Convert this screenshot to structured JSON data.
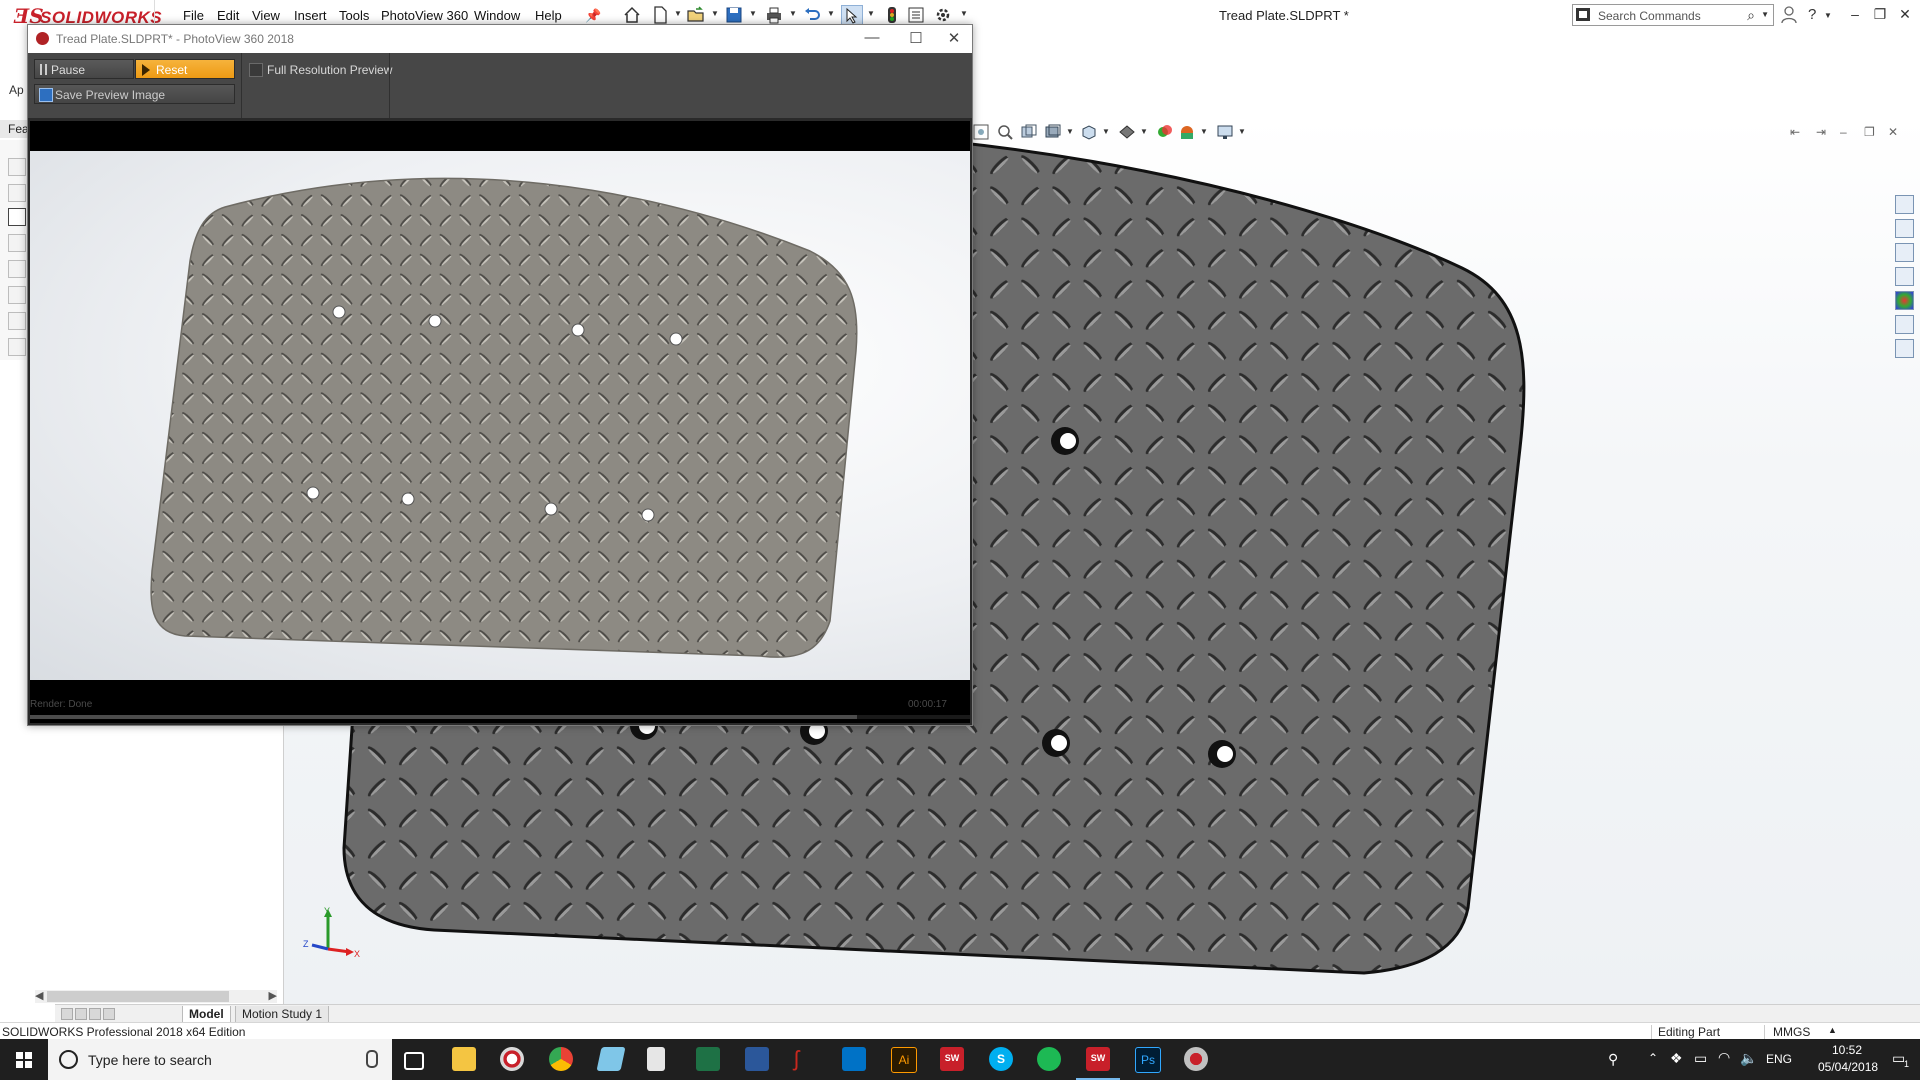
{
  "app": {
    "brand_prefix": "3DS",
    "brand": "SOLIDWORKS",
    "doc_title": "Tread Plate.SLDPRT *",
    "menus": [
      "File",
      "Edit",
      "View",
      "Insert",
      "Tools",
      "PhotoView 360",
      "Window",
      "Help"
    ],
    "search_placeholder": "Search Commands",
    "window_controls": {
      "minimize": "–",
      "restore": "❐",
      "close": "✕"
    }
  },
  "command_manager": {
    "tab_partial": "Ap"
  },
  "feature_panel": {
    "tab_partial": "Fea"
  },
  "bottom_tabs": {
    "model": "Model",
    "motion": "Motion Study 1"
  },
  "statusbar": {
    "edition": "SOLIDWORKS Professional 2018 x64 Edition",
    "mode": "Editing Part",
    "units": "MMGS",
    "units_arrow": "▲"
  },
  "triad": {
    "x": "X",
    "y": "Y",
    "z": "Z"
  },
  "photoview": {
    "title": "Tread Plate.SLDPRT* - PhotoView 360 2018",
    "pause_label": "Pause",
    "reset_label": "Reset",
    "save_label": "Save Preview Image",
    "fullres_label": "Full Resolution Preview",
    "fullres_checked": false,
    "render_status": "Render: Done",
    "elapsed": "00:00:17",
    "progress_fraction": 0.88,
    "controls": {
      "minimize": "—",
      "maximize": "☐",
      "close": "✕"
    }
  },
  "taskbar": {
    "search_placeholder": "Type here to search",
    "apps": [
      {
        "name": "task-view",
        "color": "#ffffff"
      },
      {
        "name": "file-explorer",
        "color": "#f4c542"
      },
      {
        "name": "solidworks-launcher",
        "color": "#d9d9d9"
      },
      {
        "name": "chrome",
        "color": "#e94235"
      },
      {
        "name": "notes",
        "color": "#7fc6e8"
      },
      {
        "name": "calculator",
        "color": "#e6e6e6"
      },
      {
        "name": "excel",
        "color": "#1e7145"
      },
      {
        "name": "word",
        "color": "#2b579a"
      },
      {
        "name": "acrobat",
        "color": "#c7281e"
      },
      {
        "name": "outlook",
        "color": "#0072c6"
      },
      {
        "name": "illustrator",
        "color": "#ff9a00"
      },
      {
        "name": "solidworks-2018-a",
        "color": "#c8202a"
      },
      {
        "name": "skype",
        "color": "#00aff0"
      },
      {
        "name": "spotify",
        "color": "#1db954"
      },
      {
        "name": "solidworks-2018-b",
        "color": "#c8202a"
      },
      {
        "name": "photoshop",
        "color": "#31a8ff"
      },
      {
        "name": "render-app",
        "color": "#c0c0c0"
      }
    ],
    "sw_badge": "2018",
    "sw_badge_text": "SW",
    "ps_text": "Ps",
    "ai_text": "Ai",
    "language": "ENG",
    "time": "10:52",
    "date": "05/04/2018",
    "notification_count": "1"
  }
}
